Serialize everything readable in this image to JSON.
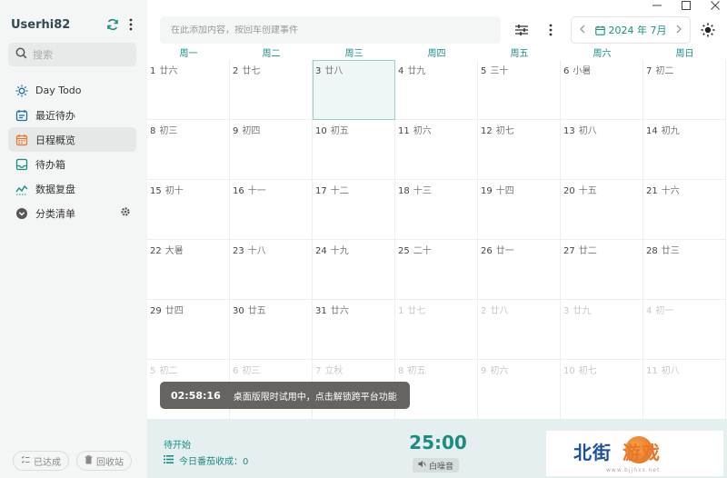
{
  "sidebar": {
    "username": "Userhi82",
    "search_placeholder": "搜索",
    "items": [
      {
        "label": "Day Todo"
      },
      {
        "label": "最近待办"
      },
      {
        "label": "日程概览"
      },
      {
        "label": "待办箱"
      },
      {
        "label": "数据复盘"
      },
      {
        "label": "分类清单"
      }
    ],
    "footer": {
      "done_label": "已达成",
      "trash_label": "回收站"
    }
  },
  "topbar": {
    "add_placeholder": "在此添加内容，按回车创建事件",
    "date_label": "2024 年 7月"
  },
  "calendar": {
    "weekdays": [
      "周一",
      "周二",
      "周三",
      "周四",
      "周五",
      "周六",
      "周日"
    ],
    "days": [
      {
        "num": "1",
        "lunar": "廿六"
      },
      {
        "num": "2",
        "lunar": "廿七"
      },
      {
        "num": "3",
        "lunar": "廿八"
      },
      {
        "num": "4",
        "lunar": "廿九"
      },
      {
        "num": "5",
        "lunar": "三十"
      },
      {
        "num": "6",
        "lunar": "小暑"
      },
      {
        "num": "7",
        "lunar": "初二"
      },
      {
        "num": "8",
        "lunar": "初三"
      },
      {
        "num": "9",
        "lunar": "初四"
      },
      {
        "num": "10",
        "lunar": "初五"
      },
      {
        "num": "11",
        "lunar": "初六"
      },
      {
        "num": "12",
        "lunar": "初七"
      },
      {
        "num": "13",
        "lunar": "初八"
      },
      {
        "num": "14",
        "lunar": "初九"
      },
      {
        "num": "15",
        "lunar": "初十"
      },
      {
        "num": "16",
        "lunar": "十一"
      },
      {
        "num": "17",
        "lunar": "十二"
      },
      {
        "num": "18",
        "lunar": "十三"
      },
      {
        "num": "19",
        "lunar": "十四"
      },
      {
        "num": "20",
        "lunar": "十五"
      },
      {
        "num": "21",
        "lunar": "十六"
      },
      {
        "num": "22",
        "lunar": "大暑"
      },
      {
        "num": "23",
        "lunar": "十八"
      },
      {
        "num": "24",
        "lunar": "十九"
      },
      {
        "num": "25",
        "lunar": "二十"
      },
      {
        "num": "26",
        "lunar": "廿一"
      },
      {
        "num": "27",
        "lunar": "廿二"
      },
      {
        "num": "28",
        "lunar": "廿三"
      },
      {
        "num": "29",
        "lunar": "廿四"
      },
      {
        "num": "30",
        "lunar": "廿五"
      },
      {
        "num": "31",
        "lunar": "廿六"
      },
      {
        "num": "1",
        "lunar": "廿七"
      },
      {
        "num": "2",
        "lunar": "廿八"
      },
      {
        "num": "3",
        "lunar": "廿九"
      },
      {
        "num": "4",
        "lunar": "初一"
      },
      {
        "num": "5",
        "lunar": "初二"
      },
      {
        "num": "6",
        "lunar": "初三"
      },
      {
        "num": "7",
        "lunar": "立秋"
      },
      {
        "num": "8",
        "lunar": "初五"
      },
      {
        "num": "9",
        "lunar": "初六"
      },
      {
        "num": "10",
        "lunar": "初七"
      },
      {
        "num": "11",
        "lunar": "初八"
      }
    ]
  },
  "toast": {
    "time": "02:58:16",
    "message": "桌面版限时试用中，点击解锁跨平台功能"
  },
  "bottom": {
    "pending_label": "待开始",
    "today_count_label": "今日番茄收成：0",
    "timer": "25:00",
    "noise_label": "白噪音"
  },
  "watermark": {
    "text_a": "北街",
    "text_b": "游戏",
    "url": "www.bjjhxs.net"
  }
}
